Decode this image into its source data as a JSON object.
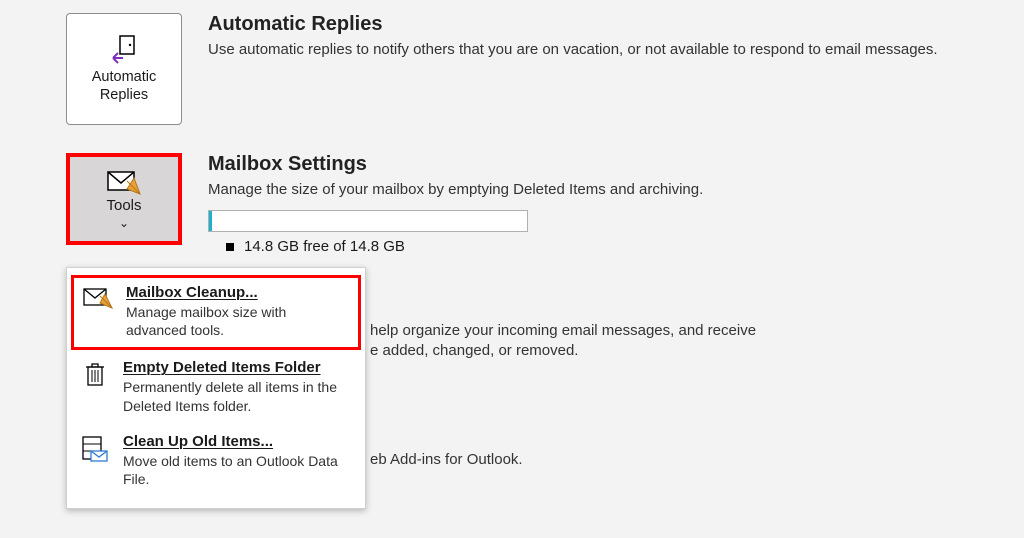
{
  "tiles": {
    "automatic_replies": {
      "label": "Automatic Replies"
    },
    "tools": {
      "label": "Tools"
    }
  },
  "sections": {
    "automatic_replies": {
      "title": "Automatic Replies",
      "desc": "Use automatic replies to notify others that you are on vacation, or not available to respond to email messages."
    },
    "mailbox_settings": {
      "title": "Mailbox Settings",
      "desc": "Manage the size of your mailbox by emptying Deleted Items and archiving.",
      "storage": "14.8 GB free of 14.8 GB"
    },
    "rules": {
      "desc_line1": "help organize your incoming email messages, and receive",
      "desc_line2": "e added, changed, or removed."
    },
    "addins": {
      "desc": "eb Add-ins for Outlook."
    }
  },
  "tools_menu": {
    "cleanup": {
      "title": "Mailbox Cleanup...",
      "desc": "Manage mailbox size with advanced tools."
    },
    "empty": {
      "title": "Empty Deleted Items Folder",
      "desc": "Permanently delete all items in the Deleted Items folder."
    },
    "cleanold": {
      "title": "Clean Up Old Items...",
      "desc": "Move old items to an Outlook Data File."
    }
  }
}
